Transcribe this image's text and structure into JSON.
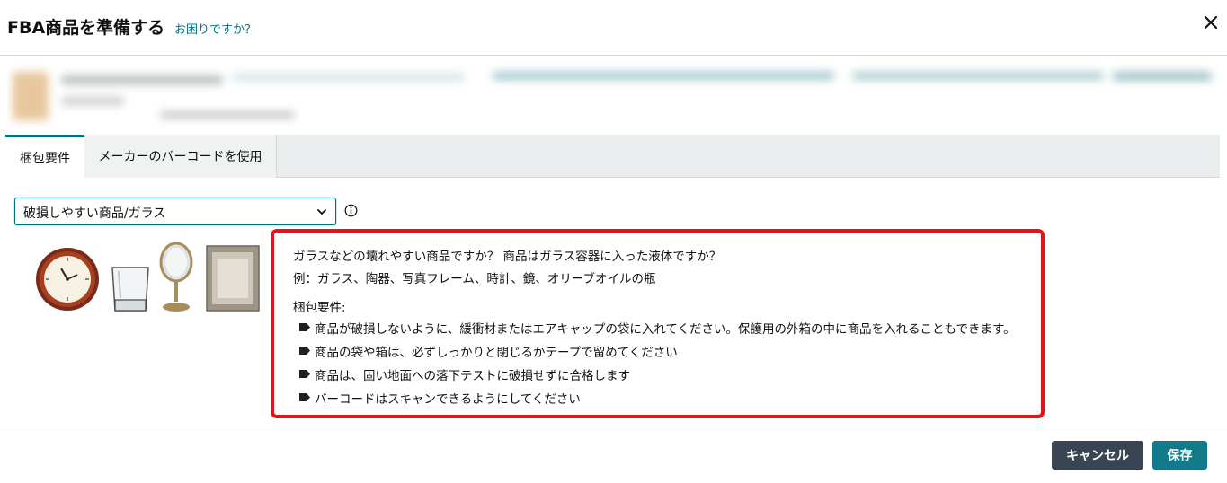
{
  "header": {
    "title": "FBA商品を準備する",
    "help_link": "お困りですか？"
  },
  "tabs": [
    {
      "label": "梱包要件",
      "active": true
    },
    {
      "label": "メーカーのバーコードを使用",
      "active": false
    }
  ],
  "category_select": {
    "selected": "破損しやすい商品/ガラス"
  },
  "illustrations": [
    "wall-clock",
    "drinking-glass",
    "table-mirror",
    "photo-frame"
  ],
  "requirements": {
    "question": "ガラスなどの壊れやすい商品ですか？ 商品はガラス容器に入った液体ですか？",
    "examples": "例：ガラス、陶器、写真フレーム、時計、鏡、オリーブオイルの瓶",
    "heading": "梱包要件:",
    "items": [
      "商品が破損しないように、緩衝材またはエアキャップの袋に入れてください。保護用の外箱の中に商品を入れることもできます。",
      "商品の袋や箱は、必ずしっかりと閉じるかテープで留めてください",
      "商品は、固い地面への落下テストに破損せずに合格します",
      "バーコードはスキャンできるようにしてください"
    ]
  },
  "footer": {
    "cancel_label": "キャンセル",
    "save_label": "保存"
  },
  "colors": {
    "link": "#007185",
    "highlight_border": "#e0141e",
    "cancel_button": "#3a4553",
    "save_button": "#137a8a"
  }
}
